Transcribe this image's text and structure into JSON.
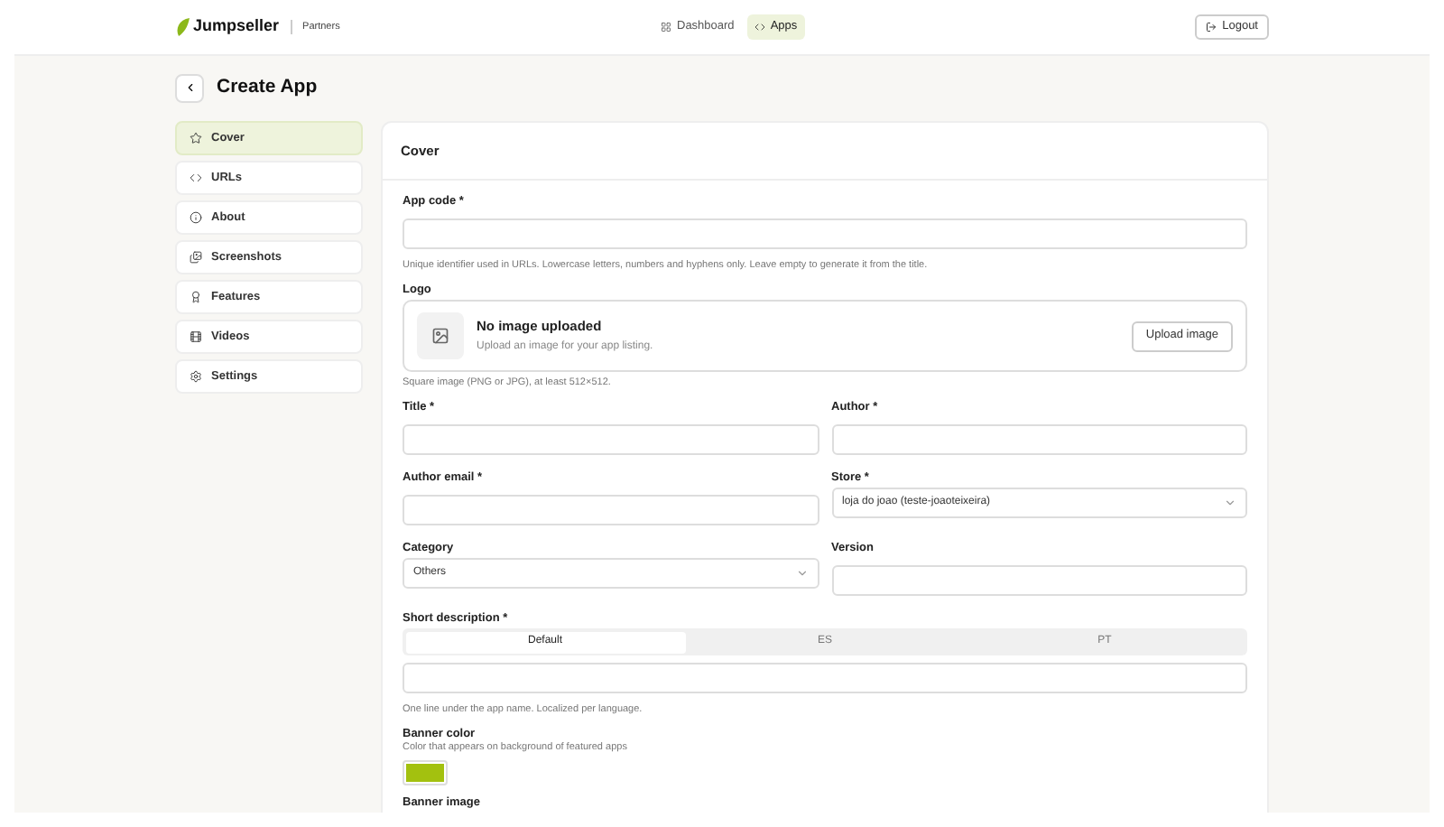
{
  "nav": {
    "brand": "Jumpseller",
    "section": "Partners",
    "links": [
      {
        "label": "Dashboard",
        "selected": false
      },
      {
        "label": "Apps",
        "selected": true
      }
    ],
    "logout": "Logout"
  },
  "page": {
    "title": "Create App"
  },
  "sidebar": {
    "items": [
      {
        "label": "Cover",
        "selected": true
      },
      {
        "label": "URLs",
        "selected": false
      },
      {
        "label": "About",
        "selected": false
      },
      {
        "label": "Screenshots",
        "selected": false
      },
      {
        "label": "Features",
        "selected": false
      },
      {
        "label": "Videos",
        "selected": false
      },
      {
        "label": "Settings",
        "selected": false
      }
    ]
  },
  "form": {
    "title": "Cover",
    "rows": [
      {
        "fields": [
          {
            "kind": "text",
            "label": "App code *",
            "help": "Unique identifier used in URLs. Lowercase letters, numbers and hyphens only. Leave empty to generate it from the title."
          }
        ]
      },
      {
        "fields": [
          {
            "kind": "upload",
            "label": "Logo",
            "heading": "No image uploaded",
            "text": "Upload an image for your app listing.",
            "button": "Upload image",
            "help": "Square image (PNG or JPG), at least 512×512."
          }
        ]
      },
      {
        "fields": [
          {
            "kind": "text",
            "label": "Title *"
          },
          {
            "kind": "text",
            "label": "Author *"
          }
        ]
      },
      {
        "fields": [
          {
            "kind": "text",
            "label": "Author email *"
          },
          {
            "kind": "select",
            "label": "Store *",
            "value": "loja do joao (teste-joaoteixeira)"
          }
        ]
      },
      {
        "fields": [
          {
            "kind": "select",
            "label": "Category",
            "value": "Others"
          },
          {
            "kind": "text",
            "label": "Version"
          }
        ]
      },
      {
        "fields": [
          {
            "kind": "lang",
            "label": "Short description *",
            "tabs": [
              {
                "label": "Default",
                "selected": true
              },
              {
                "label": "ES",
                "selected": false
              },
              {
                "label": "PT",
                "selected": false
              }
            ],
            "help": "One line under the app name. Localized per language."
          }
        ]
      },
      {
        "fields": [
          {
            "kind": "color",
            "label": "Banner color",
            "note": "Color that appears on background of featured apps",
            "color": "#a3c10f"
          }
        ]
      },
      {
        "fields": [
          {
            "kind": "upload_cut",
            "label": "Banner image"
          }
        ]
      }
    ]
  }
}
